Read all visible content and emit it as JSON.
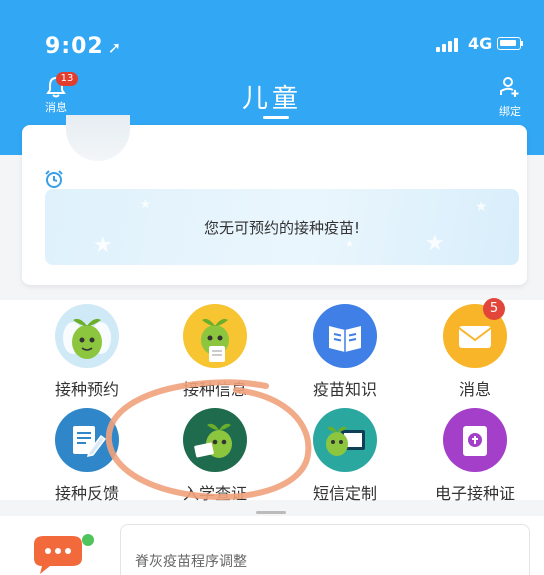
{
  "status_bar": {
    "time": "9:02",
    "network": "4G"
  },
  "nav": {
    "messages_label": "消息",
    "messages_badge": "13",
    "title": "儿童",
    "bind_label": "绑定"
  },
  "appointment": {
    "message": "您无可预约的接种疫苗!"
  },
  "grid": {
    "items": [
      {
        "label": "接种预约",
        "icon": "sprout-character-icon"
      },
      {
        "label": "接种信息",
        "icon": "sprout-document-icon"
      },
      {
        "label": "疫苗知识",
        "icon": "book-icon"
      },
      {
        "label": "消息",
        "icon": "envelope-icon",
        "badge": "5"
      },
      {
        "label": "接种反馈",
        "icon": "edit-document-icon"
      },
      {
        "label": "入学查证",
        "icon": "sprout-certificate-icon"
      },
      {
        "label": "短信定制",
        "icon": "sprout-screen-icon"
      },
      {
        "label": "电子接种证",
        "icon": "certificate-badge-icon"
      }
    ]
  },
  "news": {
    "headline": "脊灰疫苗程序调整"
  },
  "colors": {
    "primary": "#32a7f4",
    "badge": "#e33d2e",
    "annotation": "#f1a27c"
  }
}
